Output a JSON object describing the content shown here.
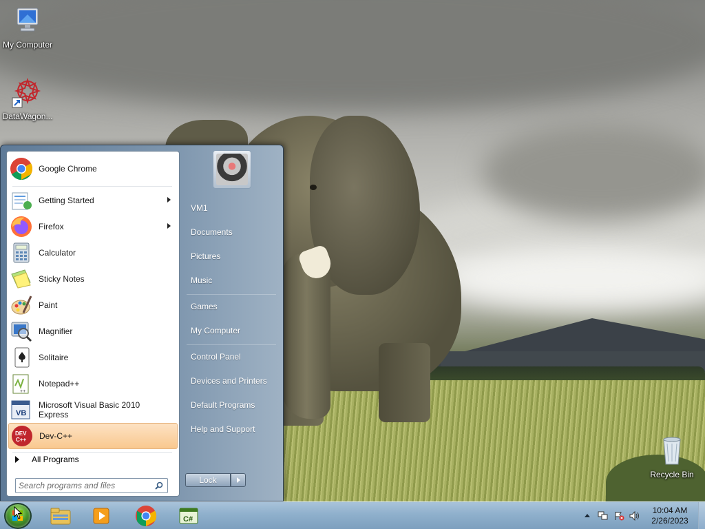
{
  "desktop": {
    "icons": [
      {
        "label": "My Computer"
      },
      {
        "label": "DataWagon..."
      },
      {
        "label": "Recycle Bin"
      }
    ]
  },
  "start_menu": {
    "pinned": [
      {
        "label": "Google Chrome",
        "icon": "chrome-icon",
        "has_submenu": false
      },
      {
        "label": "Getting Started",
        "icon": "getting-started-icon",
        "has_submenu": true
      },
      {
        "label": "Firefox",
        "icon": "firefox-icon",
        "has_submenu": true
      },
      {
        "label": "Calculator",
        "icon": "calculator-icon",
        "has_submenu": false
      },
      {
        "label": "Sticky Notes",
        "icon": "sticky-notes-icon",
        "has_submenu": false
      },
      {
        "label": "Paint",
        "icon": "paint-icon",
        "has_submenu": false
      },
      {
        "label": "Magnifier",
        "icon": "magnifier-icon",
        "has_submenu": false
      },
      {
        "label": "Solitaire",
        "icon": "solitaire-icon",
        "has_submenu": false
      },
      {
        "label": "Notepad++",
        "icon": "notepadpp-icon",
        "has_submenu": false
      },
      {
        "label": "Microsoft Visual Basic 2010",
        "label2": "Express",
        "icon": "visual-basic-icon",
        "has_submenu": false
      },
      {
        "label": "Dev-C++",
        "icon": "devcpp-icon",
        "has_submenu": false,
        "selected": true
      }
    ],
    "all_programs": "All Programs",
    "search_placeholder": "Search programs and files",
    "right": {
      "user": "VM1",
      "documents": "Documents",
      "pictures": "Pictures",
      "music": "Music",
      "games": "Games",
      "my_computer": "My Computer",
      "control_panel": "Control Panel",
      "devices_printers": "Devices and Printers",
      "default_programs": "Default Programs",
      "help_support": "Help and Support"
    },
    "lock_label": "Lock"
  },
  "taskbar": {
    "time": "10:04 AM",
    "date": "2/26/2023",
    "pinned_icons": [
      "windows-explorer-icon",
      "media-player-icon",
      "chrome-icon",
      "csharp-express-icon"
    ]
  },
  "colors": {
    "taskbar": "#8fb0cc",
    "start_menu_right": "#7d95ad",
    "selected_item": "#f9c88f"
  }
}
